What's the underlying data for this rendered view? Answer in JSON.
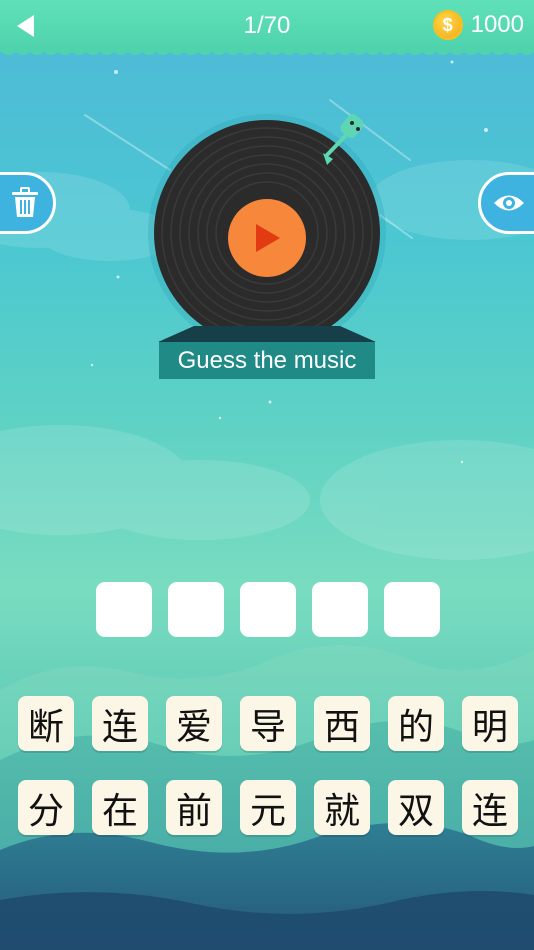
{
  "header": {
    "level": "1/70",
    "coins": "1000",
    "coin_symbol": "$"
  },
  "player": {
    "caption": "Guess the music"
  },
  "answer": {
    "slots": [
      "",
      "",
      "",
      "",
      ""
    ]
  },
  "choices": {
    "row1": [
      "断",
      "连",
      "爱",
      "导",
      "西",
      "的",
      "明"
    ],
    "row2": [
      "分",
      "在",
      "前",
      "元",
      "就",
      "双",
      "连"
    ]
  },
  "icons": {
    "back": "back-arrow-icon",
    "coin": "coin-icon",
    "trash": "trash-icon",
    "eye": "eye-icon",
    "play": "play-icon",
    "record": "vinyl-record-icon"
  },
  "colors": {
    "header": "#52d6b0",
    "side_button": "#3fb3e0",
    "play": "#f6873b",
    "caption_bg": "#1f8a86",
    "tile": "#fbf6e6"
  }
}
